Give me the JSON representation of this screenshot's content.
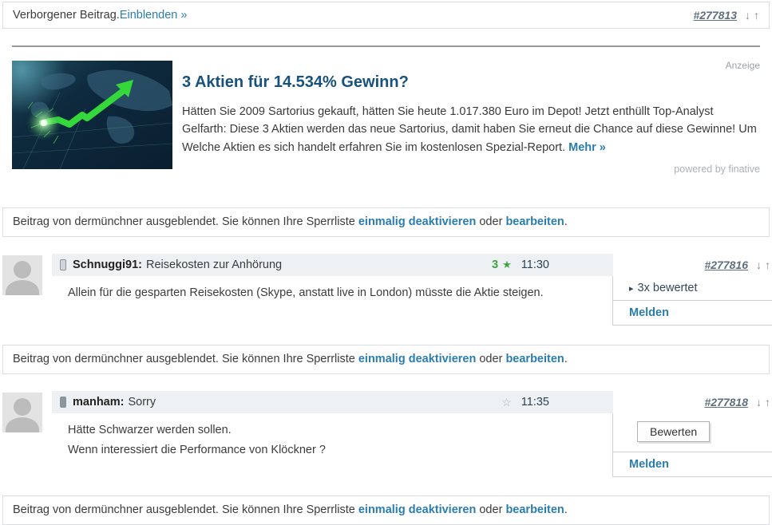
{
  "colors": {
    "link": "#2b7dad",
    "ad_title": "#18527c",
    "rating_green": "#3fa33f",
    "text": "#3c3c3c",
    "header_bg": "#eef1f3"
  },
  "icons": {
    "down_arrow": "↓",
    "up_arrow": "↑",
    "star_filled": "★",
    "star_empty": "☆",
    "caret": "▸"
  },
  "hidden_bar": {
    "text": "Verborgener Beitrag. ",
    "link": "Einblenden »",
    "post_id": "#277813"
  },
  "ad": {
    "label": "Anzeige",
    "title": "3 Aktien für 14.534% Gewinn?",
    "body": "Hätten Sie 2009 Sartorius gekauft, hätten Sie heute 1.017.380 Euro im Depot! Jetzt enthüllt Top-Analyst Gelfarth: Diese 3 Aktien werden das neue Sartorius, damit haben Sie erneut die Chance auf diese Gewinne! Um Welche Aktien es sich handelt erfahren Sie im kostenlosen Spezial-Report. ",
    "more_link": "Mehr »",
    "powered_by": "powered by finative"
  },
  "blocked_bar": {
    "prefix": "Beitrag von dermünchner ausgeblendet. Sie können Ihre Sperrliste ",
    "link_deactivate": "einmalig deaktivieren",
    "connector": " oder ",
    "link_edit": "bearbeiten",
    "period": "."
  },
  "posts": [
    {
      "author": "Schnuggi91:",
      "title": "Reisekosten zur Anhörung",
      "rating_count": "3",
      "time": "11:30",
      "post_id": "#277816",
      "body": [
        "Allein für die gesparten Reisekosten (Skype, anstatt live in London) müsste die Aktie steigen."
      ],
      "rated_label": "3x bewertet",
      "report_label": "Melden"
    },
    {
      "author": "manham:",
      "title": "Sorry",
      "time": "11:35",
      "post_id": "#277818",
      "body": [
        "Hätte Schwarzer werden sollen.",
        "Wenn interessiert die Performance von Klöckner ?"
      ],
      "rate_button": "Bewerten",
      "report_label": "Melden"
    }
  ]
}
